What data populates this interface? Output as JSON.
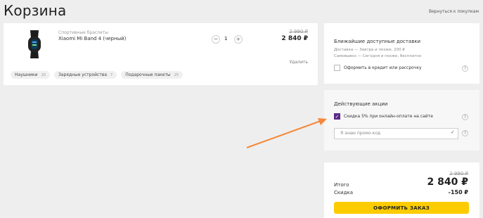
{
  "page": {
    "title": "Корзина",
    "back_link": "Вернуться к покупкам"
  },
  "item": {
    "category": "Спортивные браслеты",
    "name": "Xiaomi Mi Band 4 (черный)",
    "quantity": "1",
    "old_price": "2 990 ₽",
    "price": "2 840 ₽",
    "delete_label": "Удалить"
  },
  "chips": [
    {
      "label": "Наушники",
      "count": "10"
    },
    {
      "label": "Зарядные устройства",
      "count": "7"
    },
    {
      "label": "Подарочные пакеты",
      "count": "25"
    }
  ],
  "delivery": {
    "title": "Ближайшие доступные доставки",
    "line1": "Доставка — Завтра и позже, 200 ₽",
    "line2": "Самовывоз — Сегодня и позже, бесплатно",
    "credit_label": "Оформить в кредит или рассрочку",
    "credit_checked": false
  },
  "promo": {
    "title": "Действующие акции",
    "discount_label": "Скидка 5% при онлайн-оплате на сайте",
    "discount_checked": true,
    "promo_placeholder": "Я знаю промо-код"
  },
  "totals": {
    "old_total": "2 990 ₽",
    "total_label": "Итого",
    "total_value": "2 840 ₽",
    "discount_label": "Скидка",
    "discount_value": "-150 ₽",
    "order_button": "ОФОРМИТЬ ЗАКАЗ"
  },
  "colors": {
    "accent_button": "#fccc00",
    "checkbox_checked": "#5b2a86",
    "annotation_arrow": "#f5883a"
  }
}
